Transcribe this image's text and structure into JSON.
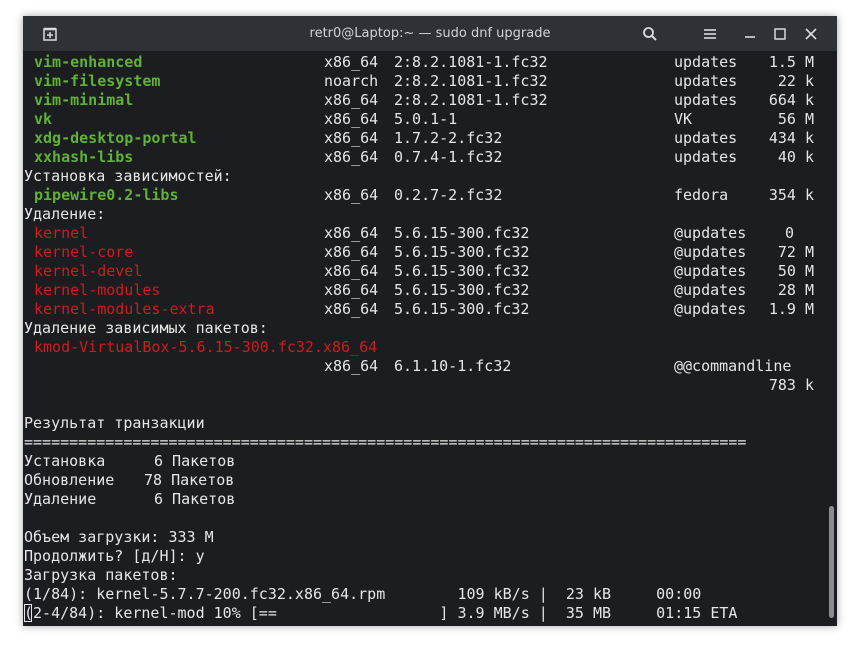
{
  "window": {
    "title": "retr0@Laptop:~ — sudo dnf upgrade"
  },
  "terminal": {
    "pkgs_top": [
      {
        "name": "vim-enhanced",
        "arch": "x86_64",
        "ver": "2:8.2.1081-1.fc32",
        "repo": "updates",
        "size": "1.5 M"
      },
      {
        "name": "vim-filesystem",
        "arch": "noarch",
        "ver": "2:8.2.1081-1.fc32",
        "repo": "updates",
        "size": "22 k"
      },
      {
        "name": "vim-minimal",
        "arch": "x86_64",
        "ver": "2:8.2.1081-1.fc32",
        "repo": "updates",
        "size": "664 k"
      },
      {
        "name": "vk",
        "arch": "x86_64",
        "ver": "5.0.1-1",
        "repo": "VK",
        "size": "56 M"
      },
      {
        "name": "xdg-desktop-portal",
        "arch": "x86_64",
        "ver": "1.7.2-2.fc32",
        "repo": "updates",
        "size": "434 k"
      },
      {
        "name": "xxhash-libs",
        "arch": "x86_64",
        "ver": "0.7.4-1.fc32",
        "repo": "updates",
        "size": "40 k"
      }
    ],
    "deps_header": "Установка зависимостей:",
    "deps": [
      {
        "name": "pipewire0.2-libs",
        "arch": "x86_64",
        "ver": "0.2.7-2.fc32",
        "repo": "fedora",
        "size": "354 k"
      }
    ],
    "remove_header": "Удаление:",
    "removals": [
      {
        "name": "kernel",
        "arch": "x86_64",
        "ver": "5.6.15-300.fc32",
        "repo": "@updates",
        "size": "0"
      },
      {
        "name": "kernel-core",
        "arch": "x86_64",
        "ver": "5.6.15-300.fc32",
        "repo": "@updates",
        "size": "72 M"
      },
      {
        "name": "kernel-devel",
        "arch": "x86_64",
        "ver": "5.6.15-300.fc32",
        "repo": "@updates",
        "size": "50 M"
      },
      {
        "name": "kernel-modules",
        "arch": "x86_64",
        "ver": "5.6.15-300.fc32",
        "repo": "@updates",
        "size": "28 M"
      },
      {
        "name": "kernel-modules-extra",
        "arch": "x86_64",
        "ver": "5.6.15-300.fc32",
        "repo": "@updates",
        "size": "1.9 M"
      }
    ],
    "remove_deps_header": "Удаление зависимых пакетов:",
    "kmod": {
      "name": "kmod-VirtualBox-5.6.15-300.fc32.x86_64",
      "arch": "x86_64",
      "ver": "6.1.10-1.fc32",
      "repo": "@@commandline",
      "size": "783 k"
    },
    "summary_header": "Результат транзакции",
    "separator": "================================================================================",
    "summary": [
      {
        "label": "Установка",
        "count": "6 Пакетов"
      },
      {
        "label": "Обновление",
        "count": "78 Пакетов"
      },
      {
        "label": "Удаление",
        "count": "6 Пакетов"
      }
    ],
    "download_size": "Объем загрузки: 333 M",
    "prompt": "Продолжить? [д/Н]: y",
    "downloading": "Загрузка пакетов:",
    "progress1": "(1/84): kernel-5.7.7-200.fc32.x86_64.rpm        109 kB/s |  23 kB     00:00",
    "progress2": "(2-4/84): kernel-mod 10% [==                  ] 3.9 MB/s |  35 MB     01:15 ETA"
  }
}
